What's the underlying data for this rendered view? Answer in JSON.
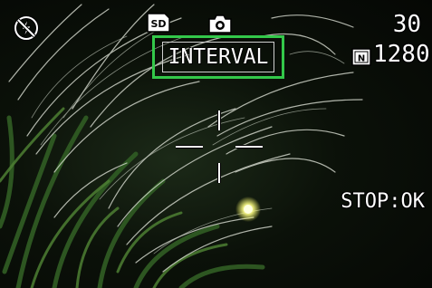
{
  "viewfinder": {
    "flash_icon": "flash-off-icon",
    "storage_icon": "sd-card-icon",
    "storage_label": "SD",
    "shooting_mode_icon": "camera-icon",
    "mode_label": "INTERVAL",
    "shots_remaining": "30",
    "quality_icon": "quality-normal-icon",
    "quality_label": "N",
    "resolution": "1280",
    "stop_hint": "STOP:OK",
    "focus_frame_icon": "af-frame-icon"
  },
  "colors": {
    "osd_text": "#ffffff",
    "mode_highlight": "#33c84a",
    "background": "#0b1109"
  }
}
